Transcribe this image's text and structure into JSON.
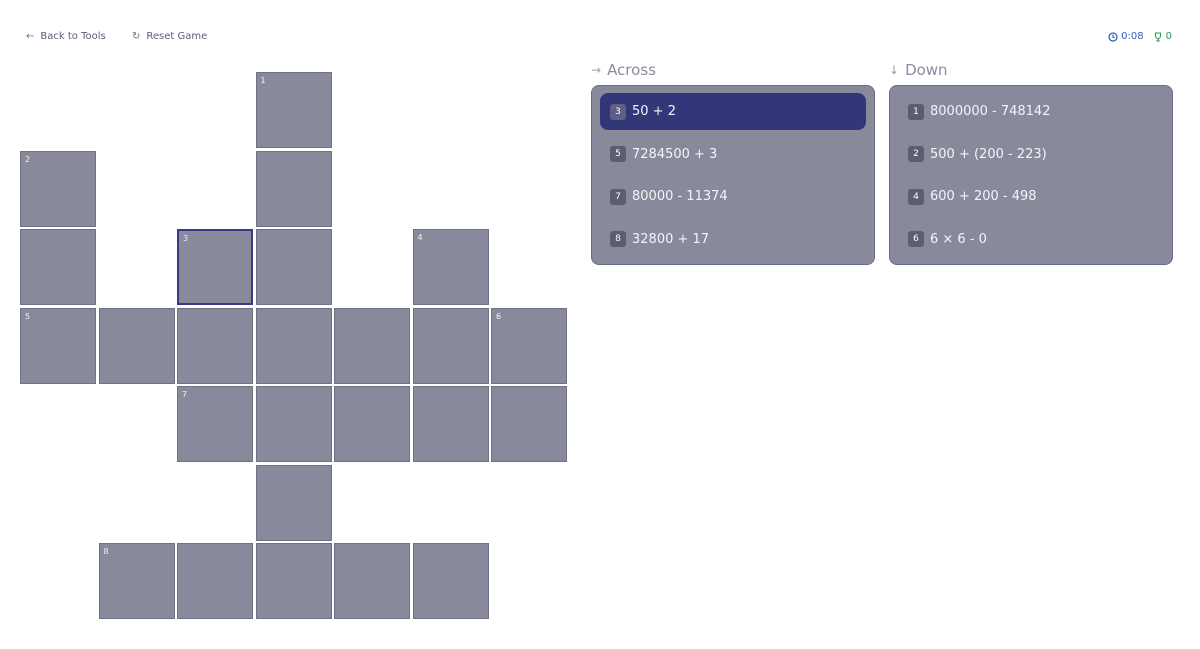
{
  "topbar": {
    "back_label": "Back to Tools",
    "reset_label": "Reset Game",
    "time": "0:08",
    "score": "0"
  },
  "grid": {
    "cells": [
      {
        "r": 0,
        "c": 3,
        "num": "1"
      },
      {
        "r": 1,
        "c": 0,
        "num": "2"
      },
      {
        "r": 1,
        "c": 3
      },
      {
        "r": 2,
        "c": 0
      },
      {
        "r": 2,
        "c": 2,
        "num": "3",
        "active": true
      },
      {
        "r": 2,
        "c": 3
      },
      {
        "r": 2,
        "c": 5,
        "num": "4"
      },
      {
        "r": 3,
        "c": 0,
        "num": "5"
      },
      {
        "r": 3,
        "c": 1
      },
      {
        "r": 3,
        "c": 2
      },
      {
        "r": 3,
        "c": 3
      },
      {
        "r": 3,
        "c": 4
      },
      {
        "r": 3,
        "c": 5
      },
      {
        "r": 3,
        "c": 6,
        "num": "6"
      },
      {
        "r": 4,
        "c": 2,
        "num": "7"
      },
      {
        "r": 4,
        "c": 3
      },
      {
        "r": 4,
        "c": 4
      },
      {
        "r": 4,
        "c": 5
      },
      {
        "r": 4,
        "c": 6
      },
      {
        "r": 5,
        "c": 3
      },
      {
        "r": 6,
        "c": 1,
        "num": "8"
      },
      {
        "r": 6,
        "c": 2
      },
      {
        "r": 6,
        "c": 3
      },
      {
        "r": 6,
        "c": 4
      },
      {
        "r": 6,
        "c": 5
      }
    ]
  },
  "across": {
    "title": "Across",
    "clues": [
      {
        "num": "3",
        "text": "50 + 2",
        "selected": true
      },
      {
        "num": "5",
        "text": "7284500 + 3"
      },
      {
        "num": "7",
        "text": "80000 - 11374"
      },
      {
        "num": "8",
        "text": "32800 + 17"
      }
    ]
  },
  "down": {
    "title": "Down",
    "clues": [
      {
        "num": "1",
        "text": "8000000 - 748142"
      },
      {
        "num": "2",
        "text": "500 + (200 - 223)"
      },
      {
        "num": "4",
        "text": "600 + 200 - 498"
      },
      {
        "num": "6",
        "text": "6 × 6 - 0"
      }
    ]
  },
  "icons": {
    "back": "arrow-left-icon",
    "reset": "refresh-icon",
    "time": "clock-icon",
    "score": "trophy-icon",
    "across": "arrow-right-icon",
    "down": "arrow-down-icon"
  },
  "colors": {
    "cell": "#888a9b",
    "selected_clue": "#34367a",
    "active_cell_border": "#353a8e",
    "time": "#2e5fb8",
    "score": "#2a9a55"
  }
}
